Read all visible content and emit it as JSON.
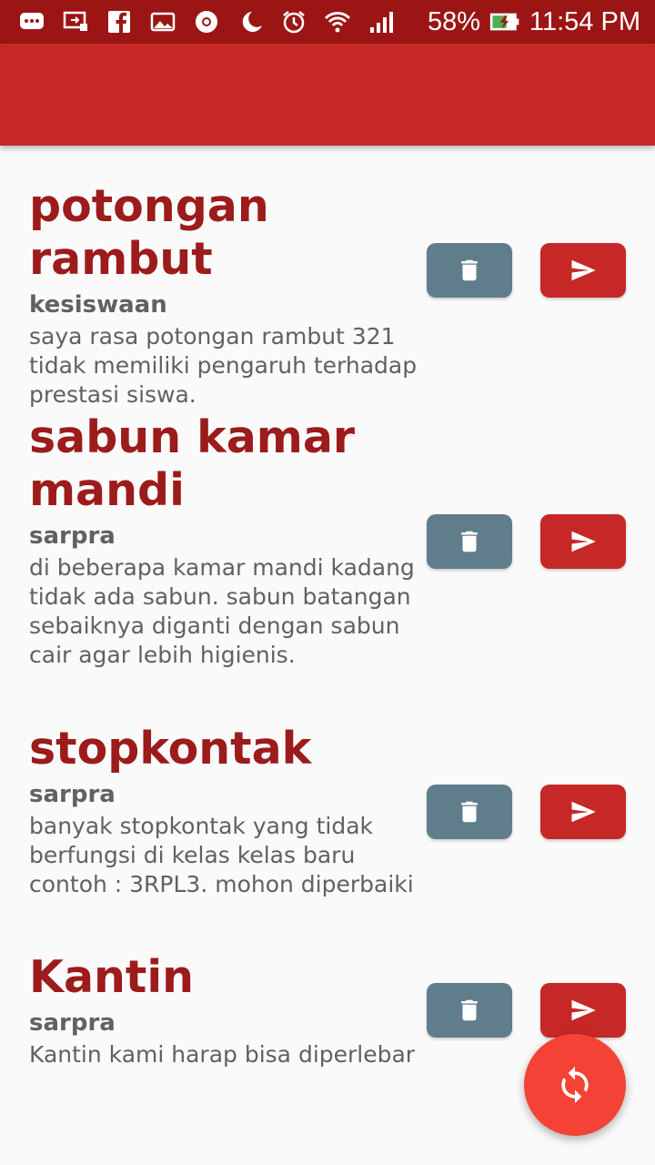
{
  "status_bar": {
    "battery": "58%",
    "time": "11:54 PM"
  },
  "items": [
    {
      "title": "potongan rambut",
      "category": "kesiswaan",
      "description": "saya rasa potongan rambut 321 tidak memiliki pengaruh terhadap prestasi siswa."
    },
    {
      "title": "sabun kamar mandi",
      "category": "sarpra",
      "description": "di beberapa kamar mandi kadang tidak ada sabun. sabun batangan sebaiknya diganti dengan sabun cair agar lebih higienis."
    },
    {
      "title": "stopkontak",
      "category": "sarpra",
      "description": "banyak stopkontak yang tidak berfungsi di kelas kelas baru contoh : 3RPL3. mohon diperbaiki"
    },
    {
      "title": "Kantin",
      "category": "sarpra",
      "description": "Kantin kami harap bisa diperlebar"
    }
  ],
  "icons": {
    "delete": "trash-icon",
    "send": "send-icon",
    "refresh": "refresh-icon"
  },
  "colors": {
    "app_bar": "#c62828",
    "status_bar": "#9c1515",
    "title": "#9c1b1b",
    "delete_button": "#607d8b",
    "send_button": "#c62828",
    "fab": "#f44336"
  }
}
